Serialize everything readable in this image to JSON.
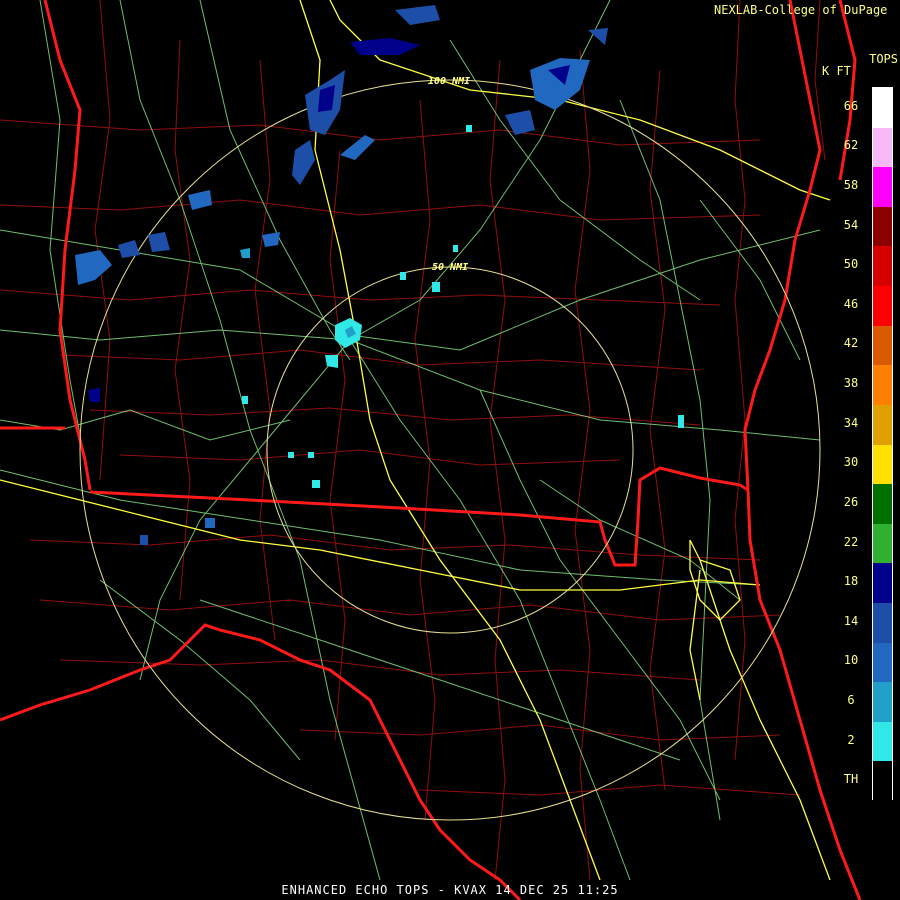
{
  "title": "ENHANCED ECHO TOPS - KVAX 14 DEC 25 11:25",
  "credit": "NEXLAB-College of DuPage",
  "legend": {
    "title": "TOPS",
    "units": "K FT",
    "labels": [
      "66",
      "62",
      "58",
      "54",
      "50",
      "46",
      "42",
      "38",
      "34",
      "30",
      "26",
      "22",
      "18",
      "14",
      "10",
      "6",
      "2",
      "TH"
    ],
    "colors": [
      "#ffffff",
      "#f7b8f7",
      "#ff00ff",
      "#8b0000",
      "#d60000",
      "#ff0000",
      "#d95a00",
      "#ff7f00",
      "#e0a000",
      "#ffe000",
      "#007000",
      "#30b030",
      "#00008b",
      "#1e4fa8",
      "#2068c0",
      "#20a0c8",
      "#30e8e8",
      "#000000"
    ]
  },
  "rings": {
    "inner_label": "50 NMI",
    "outer_label": "100 NMI"
  },
  "colors": {
    "state_border": "#ff1a1a",
    "county_border": "#a01010",
    "highway": "#ffff40",
    "roads": "#80e080",
    "ring": "#e8e090",
    "text": "#ffff80"
  }
}
